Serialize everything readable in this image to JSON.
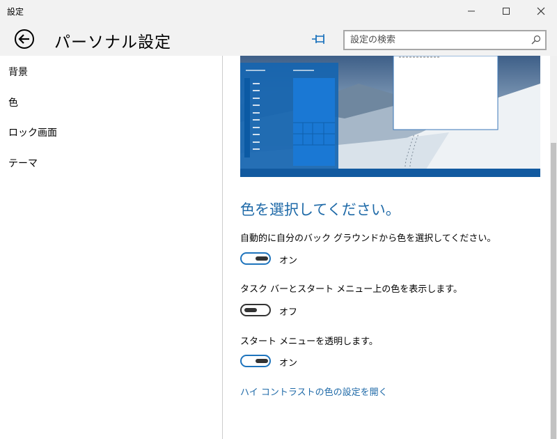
{
  "window": {
    "app_title": "設定",
    "minimize_label": "minimize",
    "maximize_label": "maximize",
    "close_label": "close"
  },
  "header": {
    "page_title": "パーソナル設定",
    "search_placeholder": "設定の検索"
  },
  "sidebar": {
    "items": [
      {
        "label": "背景"
      },
      {
        "label": "色"
      },
      {
        "label": "ロック画面"
      },
      {
        "label": "テーマ"
      }
    ]
  },
  "content": {
    "section_title": "色を選択してください。",
    "settings": [
      {
        "label": "自動的に自分のバック グラウンドから色を選択してください。",
        "state": "オン"
      },
      {
        "label": "タスク バーとスタート メニュー上の色を表示します。",
        "state": "オフ"
      },
      {
        "label": "スタート メニューを透明します。",
        "state": "オン"
      }
    ],
    "link": "ハイ コントラストの色の設定を開く"
  },
  "colors": {
    "accent": "#1e74bd",
    "link": "#1f6aa8",
    "chrome": "#f2f2f2"
  }
}
